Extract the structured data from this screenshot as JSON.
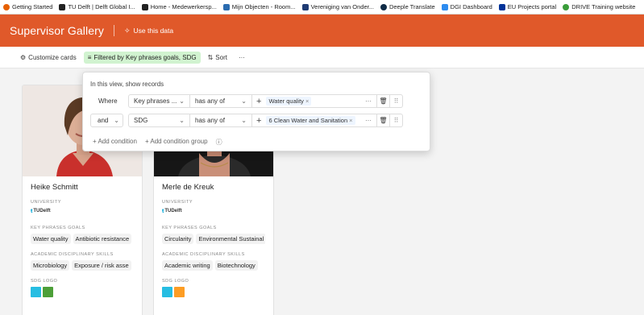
{
  "bookmarks": [
    {
      "label": "Getting Started",
      "icon": "firefox-icon",
      "color": "#e66000"
    },
    {
      "label": "TU Delft | Delft Global I...",
      "icon": "tudelft-icon",
      "color": "#222222"
    },
    {
      "label": "Home - Medewerkersp...",
      "icon": "tudelft-icon",
      "color": "#222222"
    },
    {
      "label": "Mijn Objecten - Room...",
      "icon": "objects-icon",
      "color": "#2b6cb0"
    },
    {
      "label": "Vereniging van Onder...",
      "icon": "vereniging-icon",
      "color": "#1f3b73"
    },
    {
      "label": "Deeple Translate",
      "icon": "deepl-icon",
      "color": "#0f2b46"
    },
    {
      "label": "DGI Dashboard",
      "icon": "dashboard-icon",
      "color": "#2d8cf0"
    },
    {
      "label": "EU Projects portal",
      "icon": "eu-flag-icon",
      "color": "#003399"
    },
    {
      "label": "DRIVE Training website",
      "icon": "drive-icon",
      "color": "#3a9d3a"
    }
  ],
  "header": {
    "title": "Supervisor Gallery",
    "use_data": "Use this data",
    "bg_color": "#e0592a"
  },
  "toolbar": {
    "customize": "Customize cards",
    "filter": "Filtered by Key phrases goals, SDG",
    "sort": "Sort",
    "more": "···"
  },
  "filter_panel": {
    "title": "In this view, show records",
    "rows": [
      {
        "conj": "Where",
        "field": "Key phrases ...",
        "op": "has any of",
        "value": "Water quality"
      },
      {
        "conj": "and",
        "field": "SDG",
        "op": "has any of",
        "value": "6 Clean Water and Sanitation"
      }
    ],
    "add_condition": "+ Add condition",
    "add_group": "+ Add condition group",
    "help": "ⓘ"
  },
  "labels": {
    "university": "UNIVERSITY",
    "key_phrases": "KEY PHRASES GOALS",
    "skills": "ACADEMIC DISCIPLINARY SKILLS",
    "sdg_logo": "SDG LOGO",
    "tud_logo": "TUDelft"
  },
  "cards": [
    {
      "name": "Heike Schmitt",
      "key_phrases": [
        "Water quality",
        "Antibiotic resistance"
      ],
      "skills": [
        "Microbiology",
        "Exposure / risk asse"
      ],
      "sdg_colors": [
        "#26bde2",
        "#4c9f38"
      ]
    },
    {
      "name": "Merle de Kreuk",
      "key_phrases": [
        "Circularity",
        "Environmental Sustainal"
      ],
      "skills": [
        "Academic writing",
        "Biotechnology"
      ],
      "sdg_colors": [
        "#26bde2",
        "#fd9d24"
      ]
    }
  ]
}
